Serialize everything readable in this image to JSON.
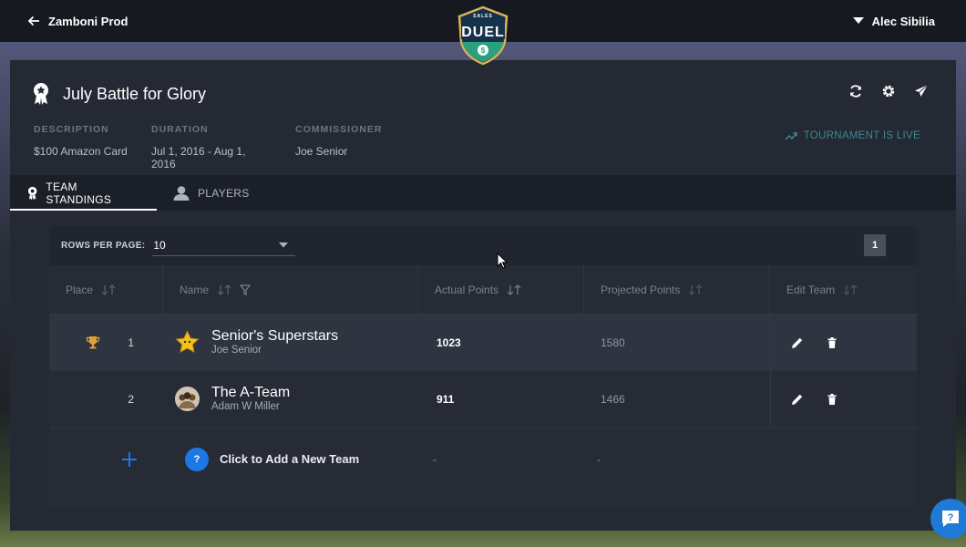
{
  "topbar": {
    "back_label": "Zamboni Prod",
    "user_name": "Alec Sibilia"
  },
  "logo": {
    "top_text": "SALES",
    "main_text": "DUEL",
    "colors": {
      "teal": "#2ba07d",
      "navy": "#15324a",
      "gold": "#d9b25a"
    }
  },
  "tournament": {
    "title": "July Battle for Glory",
    "meta": [
      {
        "label": "DESCRIPTION",
        "value": "$100 Amazon Card"
      },
      {
        "label": "DURATION",
        "value": "Jul 1, 2016 - Aug 1, 2016"
      },
      {
        "label": "COMMISSIONER",
        "value": "Joe Senior"
      }
    ],
    "status": "TOURNAMENT IS LIVE",
    "icons": [
      "refresh-icon",
      "gear-icon",
      "send-icon"
    ]
  },
  "tabs": [
    {
      "label": "TEAM STANDINGS",
      "icon": "award-icon",
      "active": true
    },
    {
      "label": "PLAYERS",
      "icon": "person-icon",
      "active": false
    }
  ],
  "table": {
    "rows_per_page_label": "ROWS PER PAGE:",
    "rows_per_page_value": "10",
    "current_page": "1",
    "columns": [
      "Place",
      "Name",
      "Actual Points",
      "Projected Points",
      "Edit Team"
    ],
    "rows": [
      {
        "place": "1",
        "name": "Senior's Superstars",
        "owner": "Joe Senior",
        "actual": "1023",
        "projected": "1580",
        "trophy": true
      },
      {
        "place": "2",
        "name": "The A-Team",
        "owner": "Adam W Miller",
        "actual": "911",
        "projected": "1466",
        "trophy": false
      }
    ],
    "add_row": {
      "icon_label": "?",
      "text": "Click to Add a New Team",
      "actual": "-",
      "projected": "-"
    }
  },
  "colors": {
    "accent": "#1e77e6",
    "live": "#3b8a8c",
    "trophy": "#e2a23a"
  }
}
